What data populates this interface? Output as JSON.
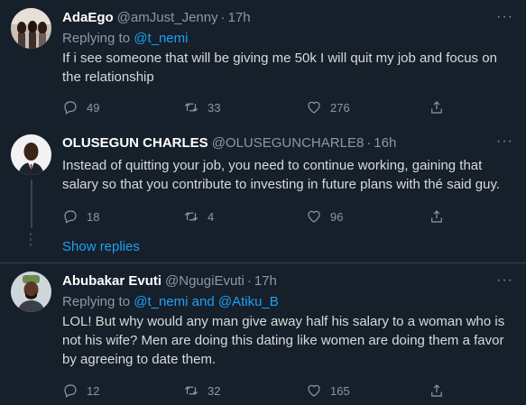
{
  "tweets": [
    {
      "name": "AdaEgo",
      "handle": "@amJust_Jenny",
      "separator": "·",
      "time": "17h",
      "replying_prefix": "Replying to",
      "replying_to": "@t_nemi",
      "replying_and": "",
      "replying_to_2": "",
      "text": "If i see someone that will be giving me 50k I will quit my job and focus on the relationship",
      "replies": "49",
      "retweets": "33",
      "likes": "276"
    },
    {
      "name": "OLUSEGUN CHARLES",
      "handle": "@OLUSEGUNCHARLE8",
      "separator": "·",
      "time": "16h",
      "text": "Instead of quitting your job, you need to continue working, gaining that salary so that you contribute to investing in future plans with thé said guy.",
      "replies": "18",
      "retweets": "4",
      "likes": "96"
    },
    {
      "name": "Abubakar Evuti",
      "handle": "@NgugiEvuti",
      "separator": "·",
      "time": "17h",
      "replying_prefix": "Replying to",
      "replying_to": "@t_nemi",
      "replying_and": "and",
      "replying_to_2": "@Atiku_B",
      "text": "LOL! But why would any man give away half his salary to a woman who is not his wife? Men are doing this dating like women are doing them a favor by agreeing to date them.",
      "replies": "12",
      "retweets": "32",
      "likes": "165"
    }
  ],
  "thread": {
    "show_replies": "Show replies"
  },
  "icons": {
    "more": "more-dots-icon",
    "reply": "reply-icon",
    "retweet": "retweet-icon",
    "like": "heart-icon",
    "share": "share-icon"
  },
  "colors": {
    "background": "#15202b",
    "accent": "#1da1f2",
    "muted": "#8899a6",
    "text": "#d9d9d9"
  }
}
